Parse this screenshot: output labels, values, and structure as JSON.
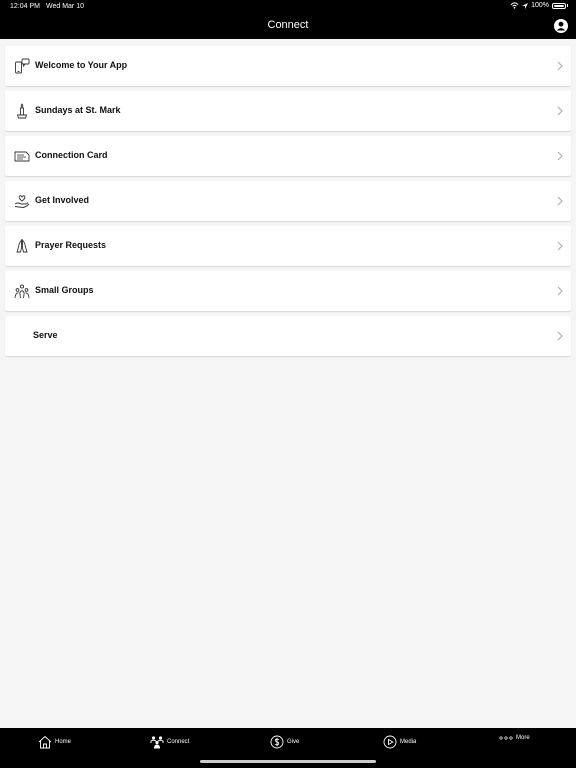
{
  "status": {
    "time": "12:04 PM",
    "date": "Wed Mar 10",
    "battery": "100%"
  },
  "header": {
    "title": "Connect"
  },
  "list": {
    "items": [
      {
        "label": "Welcome to Your App",
        "icon": "phone-chat-icon"
      },
      {
        "label": "Sundays at St. Mark",
        "icon": "candle-icon"
      },
      {
        "label": "Connection Card",
        "icon": "card-icon"
      },
      {
        "label": "Get Involved",
        "icon": "hand-heart-icon"
      },
      {
        "label": "Prayer Requests",
        "icon": "praying-hands-icon"
      },
      {
        "label": "Small Groups",
        "icon": "group-icon"
      },
      {
        "label": "Serve",
        "icon": ""
      }
    ]
  },
  "tabs": {
    "home": "Home",
    "connect": "Connect",
    "give": "Give",
    "media": "Media",
    "more": "More"
  },
  "colors": {
    "bar": "#000000",
    "background": "#f5f5f5",
    "card": "#ffffff"
  }
}
